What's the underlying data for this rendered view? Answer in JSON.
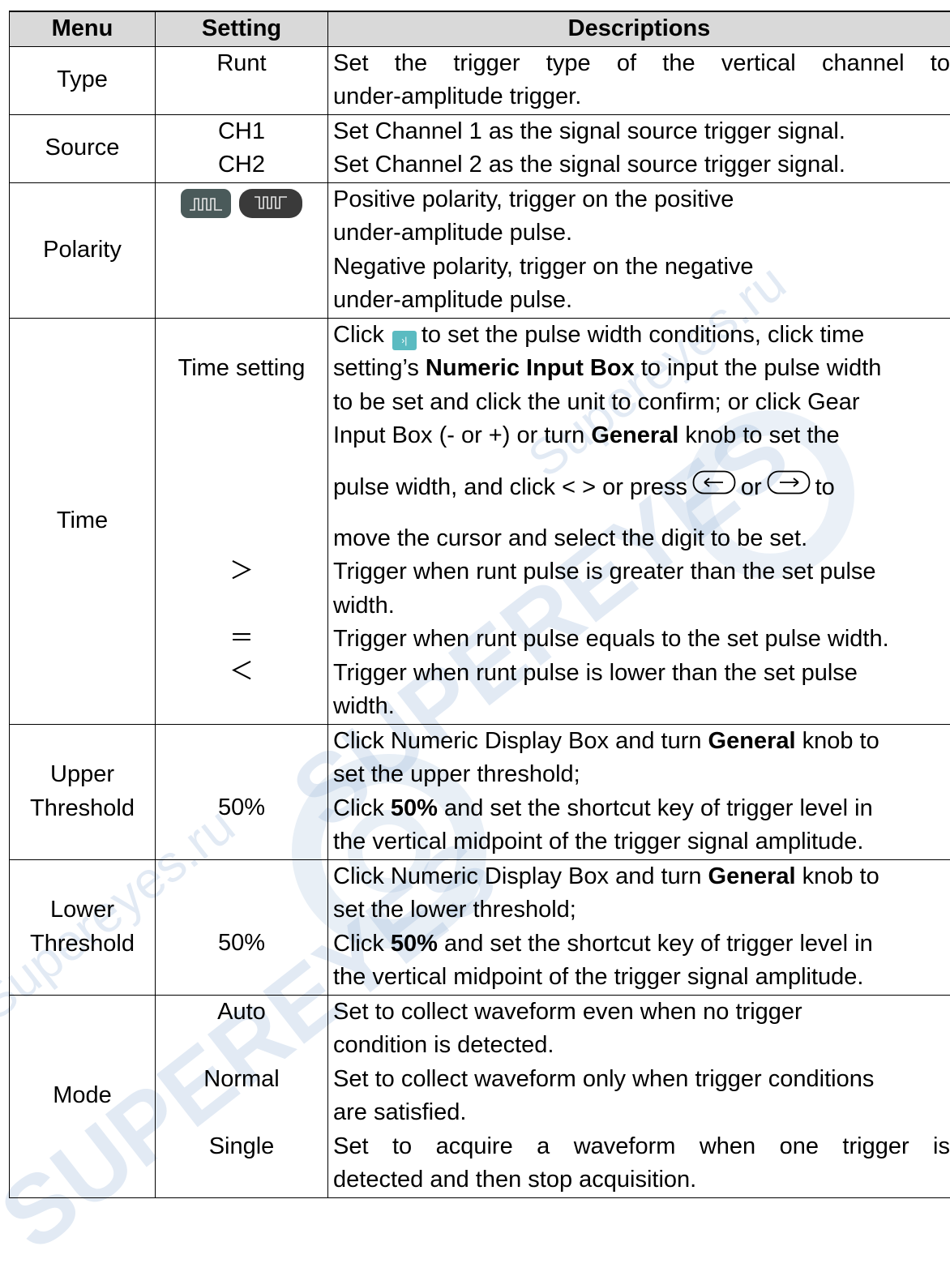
{
  "colors": {
    "header_bg": "#d9d9d9",
    "border": "#000000",
    "watermark": "#96b4d7",
    "pulse_icon": "#5bbbc1"
  },
  "icons": [
    "positive-polarity-icon",
    "negative-polarity-icon",
    "pulse-width-setting-icon",
    "left-arrow-key-icon",
    "right-arrow-key-icon"
  ],
  "watermark": [
    "Supereyes.ru",
    "SUPEREYES"
  ],
  "table": {
    "headers": [
      "Menu",
      "Setting",
      "Descriptions"
    ],
    "type": {
      "menu": "Type",
      "setting": "Runt",
      "desc": [
        "Set the trigger type of the vertical channel to",
        "under-amplitude trigger."
      ]
    },
    "source": {
      "menu": "Source",
      "settings": [
        "CH1",
        "CH2"
      ],
      "desc": [
        "Set Channel 1 as the signal source trigger signal.",
        "Set Channel 2 as the signal source trigger signal."
      ]
    },
    "polarity": {
      "menu": "Polarity",
      "desc": [
        "Positive polarity, trigger on the positive",
        "under-amplitude pulse.",
        "Negative polarity, trigger on the negative",
        "under-amplitude pulse."
      ]
    },
    "time": {
      "menu": "Time",
      "setting_time": "Time setting",
      "line1_a": "Click",
      "line1_b": "to set the pulse width conditions, click time",
      "line2_a": "setting’s ",
      "line2_bold": "Numeric Input Box",
      "line2_c": " to input the pulse width",
      "line3": "to be set and click the unit to confirm; or click Gear",
      "line4_a": "Input Box (- or +) or turn ",
      "line4_bold": "General",
      "line4_c": " knob to set the",
      "line5_a": "pulse width, and click < > or press",
      "line5_or": "or",
      "line5_to": "to",
      "line6": "move the cursor and select the digit to be set.",
      "gt": "＞",
      "gt_desc": [
        "Trigger when runt pulse is greater than the set pulse",
        "width."
      ],
      "eq": "＝",
      "eq_desc": "Trigger when runt pulse equals to the set pulse width.",
      "lt": "＜",
      "lt_desc": [
        "Trigger when runt pulse is lower than the set pulse",
        "width."
      ]
    },
    "upper": {
      "menu1": "Upper",
      "menu2": "Threshold",
      "setting": "50%",
      "l1_a": "Click Numeric Display Box and turn ",
      "l1_bold": "General",
      "l1_c": " knob to",
      "l2": "set the upper threshold;",
      "l3_a": "Click ",
      "l3_bold": "50%",
      "l3_c": " and set the shortcut key of trigger level in",
      "l4": "the vertical midpoint of the trigger signal amplitude."
    },
    "lower": {
      "menu1": "Lower",
      "menu2": "Threshold",
      "setting": "50%",
      "l1_a": "Click Numeric Display Box and turn ",
      "l1_bold": "General",
      "l1_c": " knob to",
      "l2": "set the lower threshold;",
      "l3_a": "Click ",
      "l3_bold": "50%",
      "l3_c": " and set the shortcut key of trigger level in",
      "l4": "the vertical midpoint of the trigger signal amplitude."
    },
    "mode": {
      "menu": "Mode",
      "auto": "Auto",
      "auto_desc": [
        "Set to collect waveform even when no trigger",
        "condition is detected."
      ],
      "normal": "Normal",
      "normal_desc": [
        "Set to collect waveform only when trigger conditions",
        "are satisfied."
      ],
      "single": "Single",
      "single_desc": [
        "Set to acquire a waveform when one trigger is",
        "detected and then stop acquisition."
      ]
    }
  }
}
